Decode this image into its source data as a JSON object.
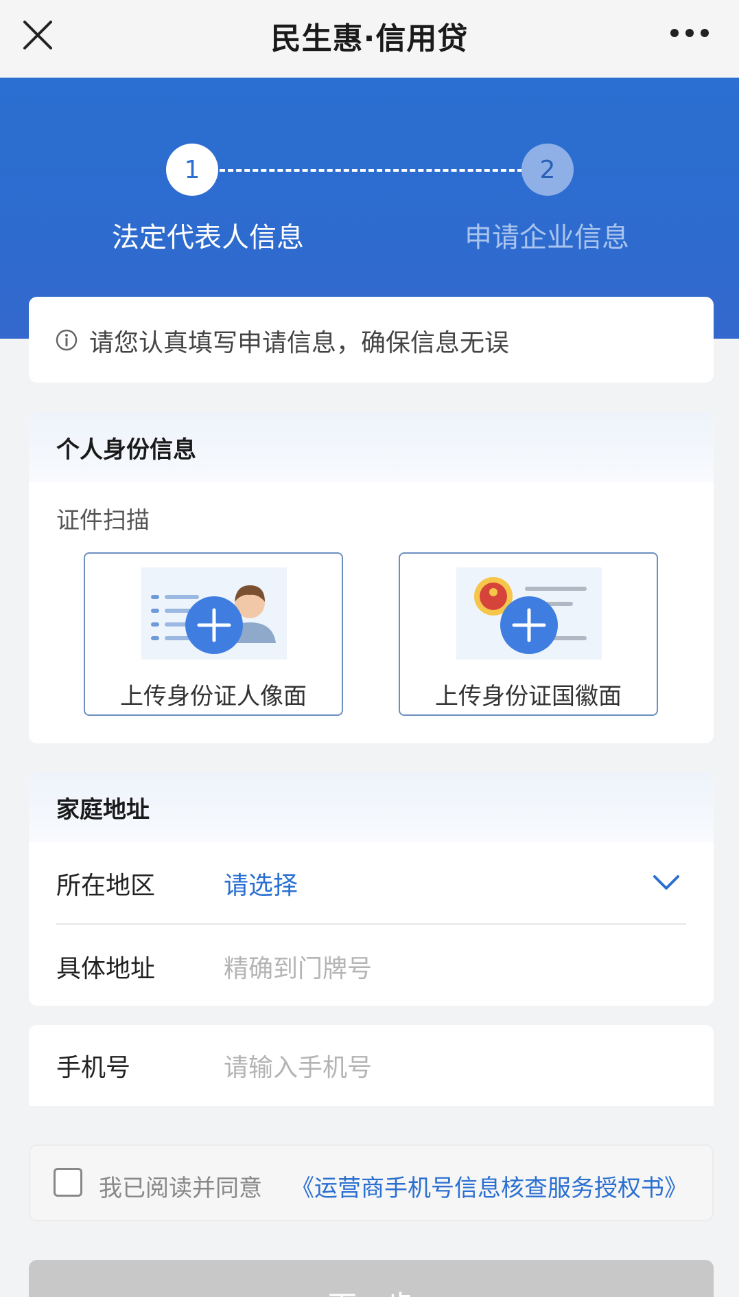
{
  "header": {
    "title": "民生惠·信用贷"
  },
  "steps": [
    {
      "number": "1",
      "label": "法定代表人信息"
    },
    {
      "number": "2",
      "label": "申请企业信息"
    }
  ],
  "notice": {
    "text": "请您认真填写申请信息，确保信息无误"
  },
  "identity": {
    "section_title": "个人身份信息",
    "scan_label": "证件扫描",
    "upload_front": "上传身份证人像面",
    "upload_back": "上传身份证国徽面"
  },
  "address": {
    "section_title": "家庭地址",
    "region_label": "所在地区",
    "region_value": "请选择",
    "detail_label": "具体地址",
    "detail_placeholder": "精确到门牌号"
  },
  "phone": {
    "label": "手机号",
    "placeholder": "请输入手机号"
  },
  "agreement": {
    "prefix": "我已阅读并同意",
    "link": "《运营商手机号信息核查服务授权书》"
  },
  "footer": {
    "next_label": "下一步"
  },
  "colors": {
    "brand_blue": "#2a6fd1",
    "step_inactive": "#8eb0e6",
    "disabled_button": "#c8c8c8"
  }
}
